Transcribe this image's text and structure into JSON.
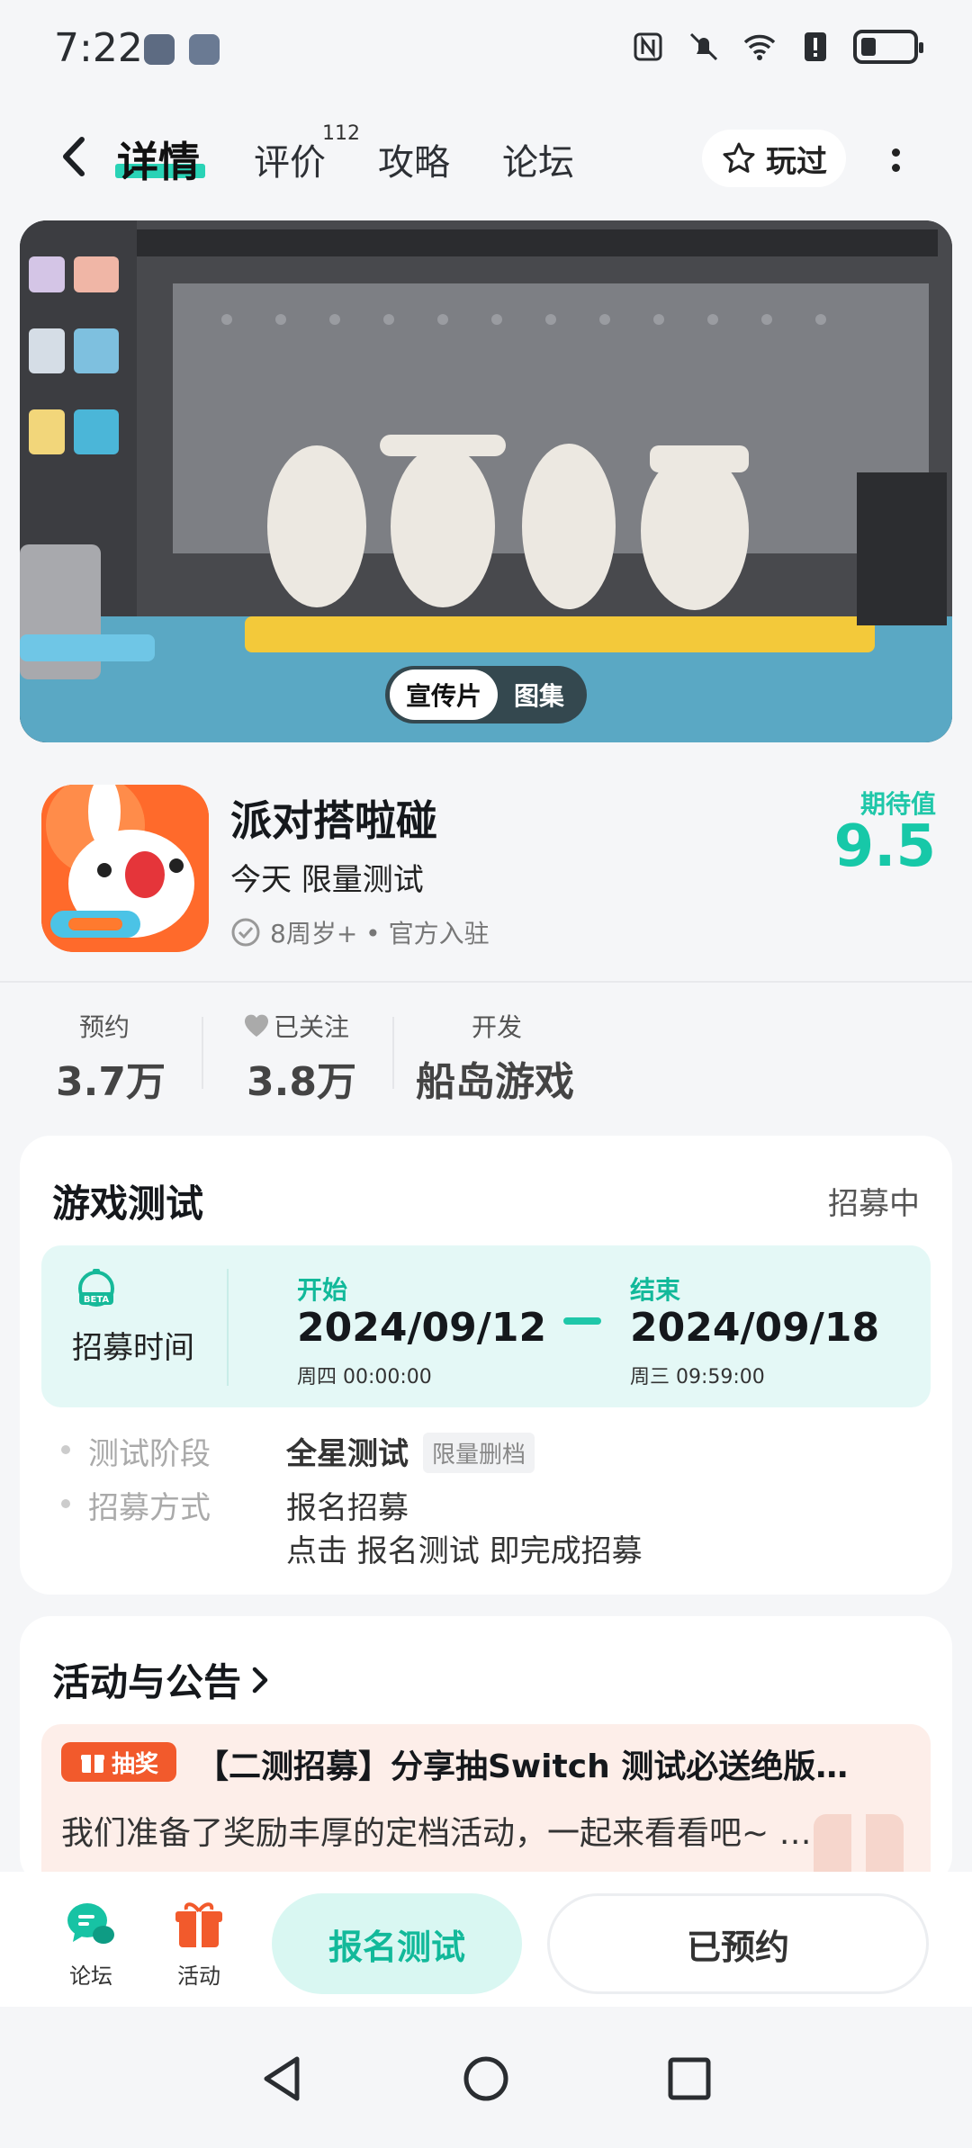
{
  "status_bar": {
    "time": "7:22",
    "icons": [
      "nfc-icon",
      "mute-icon",
      "wifi-icon",
      "alert-icon",
      "battery-icon"
    ]
  },
  "nav": {
    "tabs": [
      {
        "label": "详情",
        "active": true
      },
      {
        "label": "评价",
        "badge": "112"
      },
      {
        "label": "攻略"
      },
      {
        "label": "论坛"
      }
    ],
    "played_label": "玩过"
  },
  "hero": {
    "toggle_active": "宣传片",
    "toggle_other": "图集"
  },
  "game": {
    "name": "派对搭啦碰",
    "subtitle": "今天 限量测试",
    "meta": "8周岁+ • 官方入驻",
    "expect_label": "期待值",
    "expect_value": "9.5"
  },
  "stats": [
    {
      "label": "预约",
      "value": "3.7万"
    },
    {
      "label": "已关注",
      "value": "3.8万"
    },
    {
      "label": "开发",
      "value": "船岛游戏"
    }
  ],
  "test": {
    "title": "游戏测试",
    "status": "招募中",
    "recruit_label": "招募时间",
    "start_head": "开始",
    "start_date": "2024/09/12",
    "start_day": "周四  00:00:00",
    "end_head": "结束",
    "end_date": "2024/09/18",
    "end_day": "周三  09:59:00",
    "stage_key": "测试阶段",
    "stage_value": "全星测试",
    "stage_tag": "限量删档",
    "method_key": "招募方式",
    "method_value": "报名招募",
    "method_note": "点击 报名测试 即完成招募"
  },
  "activity": {
    "title": "活动与公告",
    "badge": "抽奖",
    "notice_title": "【二测招募】分享抽Switch 测试必送绝版…",
    "notice_text": "我们准备了奖励丰厚的定档活动，一起来看看吧~ …"
  },
  "bottom": {
    "forum_label": "论坛",
    "activity_label": "活动",
    "signup_label": "报名测试",
    "reserved_label": "已预约"
  },
  "colors": {
    "accent": "#1fc7a9",
    "accent_light": "#d9f7f2",
    "orange": "#f25a2c"
  }
}
